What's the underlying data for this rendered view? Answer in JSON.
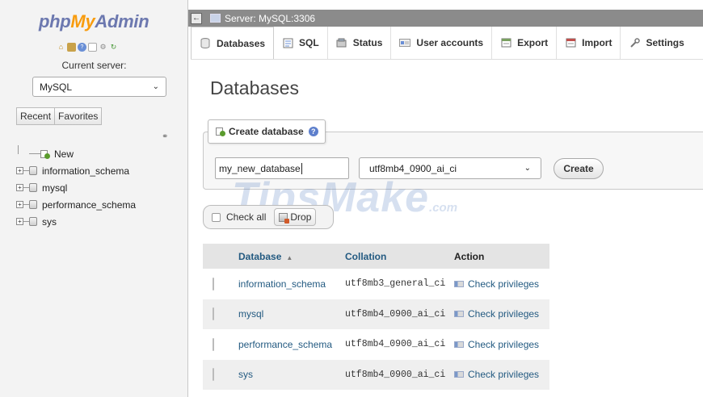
{
  "sidebar": {
    "logo": {
      "php": "php",
      "my": "My",
      "admin": "Admin"
    },
    "quick_icons": [
      "home-icon",
      "database-icon",
      "help-icon",
      "docs-icon",
      "settings-icon",
      "reload-icon"
    ],
    "current_server_label": "Current server:",
    "server_select_value": "MySQL",
    "tabs": [
      "Recent",
      "Favorites"
    ],
    "tree": {
      "new_label": "New",
      "databases": [
        "information_schema",
        "mysql",
        "performance_schema",
        "sys"
      ]
    }
  },
  "topbar": {
    "breadcrumb": "Server: MySQL:3306"
  },
  "tabs": [
    {
      "label": "Databases",
      "icon": "database-icon",
      "active": true
    },
    {
      "label": "SQL",
      "icon": "sql-icon"
    },
    {
      "label": "Status",
      "icon": "status-icon"
    },
    {
      "label": "User accounts",
      "icon": "users-icon"
    },
    {
      "label": "Export",
      "icon": "export-icon"
    },
    {
      "label": "Import",
      "icon": "import-icon"
    },
    {
      "label": "Settings",
      "icon": "settings-icon"
    }
  ],
  "page_title": "Databases",
  "create_database": {
    "legend": "Create database",
    "name_value": "my_new_database",
    "collation_value": "utf8mb4_0900_ai_ci",
    "button_label": "Create"
  },
  "watermark": {
    "main": "TipsMake",
    "suffix": ".com"
  },
  "bulk": {
    "check_all_label": "Check all",
    "drop_label": "Drop"
  },
  "table": {
    "headers": {
      "database": "Database",
      "collation": "Collation",
      "action": "Action"
    },
    "rows": [
      {
        "database": "information_schema",
        "collation": "utf8mb3_general_ci",
        "action": "Check privileges"
      },
      {
        "database": "mysql",
        "collation": "utf8mb4_0900_ai_ci",
        "action": "Check privileges"
      },
      {
        "database": "performance_schema",
        "collation": "utf8mb4_0900_ai_ci",
        "action": "Check privileges"
      },
      {
        "database": "sys",
        "collation": "utf8mb4_0900_ai_ci",
        "action": "Check privileges"
      }
    ]
  },
  "colors": {
    "topbar": "#8b8b8b",
    "link": "#235a81",
    "logo_blue": "#6c78af",
    "logo_orange": "#f89c0e"
  }
}
